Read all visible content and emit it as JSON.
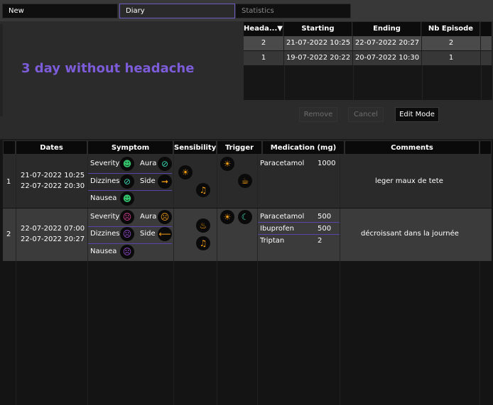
{
  "tabs": [
    {
      "label": "New"
    },
    {
      "label": "Diary"
    },
    {
      "label": "Statistics"
    }
  ],
  "headline": "3 day without headache",
  "episodes": {
    "headers": [
      "Heada...▼",
      "Starting",
      "Ending",
      "Nb Episode"
    ],
    "rows": [
      {
        "id": "2",
        "start": "21-07-2022 10:25",
        "end": "22-07-2022 20:27",
        "count": "2"
      },
      {
        "id": "1",
        "start": "19-07-2022 20:22",
        "end": "20-07-2022 10:30",
        "count": "1"
      }
    ]
  },
  "buttons": {
    "remove": "Remove",
    "cancel": "Cancel",
    "edit": "Edit Mode"
  },
  "diary": {
    "headers": [
      "Dates",
      "Symptom",
      "Sensibility",
      "Trigger",
      "Medication (mg)",
      "Comments"
    ],
    "rows": [
      {
        "num": "1",
        "date1": "21-07-2022 10:25",
        "date2": "22-07-2022 20:30",
        "symptoms": {
          "severity": "Severity",
          "aura": "Aura",
          "dizziness": "Dizziness",
          "side": "Side",
          "nausea": "Nausea"
        },
        "meds": [
          {
            "name": "Paracetamol",
            "dose": "1000"
          }
        ],
        "comment": "leger maux de tete"
      },
      {
        "num": "2",
        "date1": "22-07-2022 07:00",
        "date2": "22-07-2022 20:27",
        "symptoms": {
          "severity": "Severity",
          "aura": "Aura",
          "dizziness": "Dizziness",
          "side": "Side",
          "nausea": "Nausea"
        },
        "meds": [
          {
            "name": "Paracetamol",
            "dose": "500"
          },
          {
            "name": "Ibuprofen",
            "dose": "500"
          },
          {
            "name": "Triptan",
            "dose": "2"
          }
        ],
        "comment": "décroissant dans la journée"
      }
    ]
  },
  "colors": {
    "accent": "#7c5cd8",
    "green": "#33c26b",
    "orange": "#f39c12",
    "pink": "#e0409a",
    "purple": "#9b4dd6",
    "teal": "#36d6b0"
  }
}
